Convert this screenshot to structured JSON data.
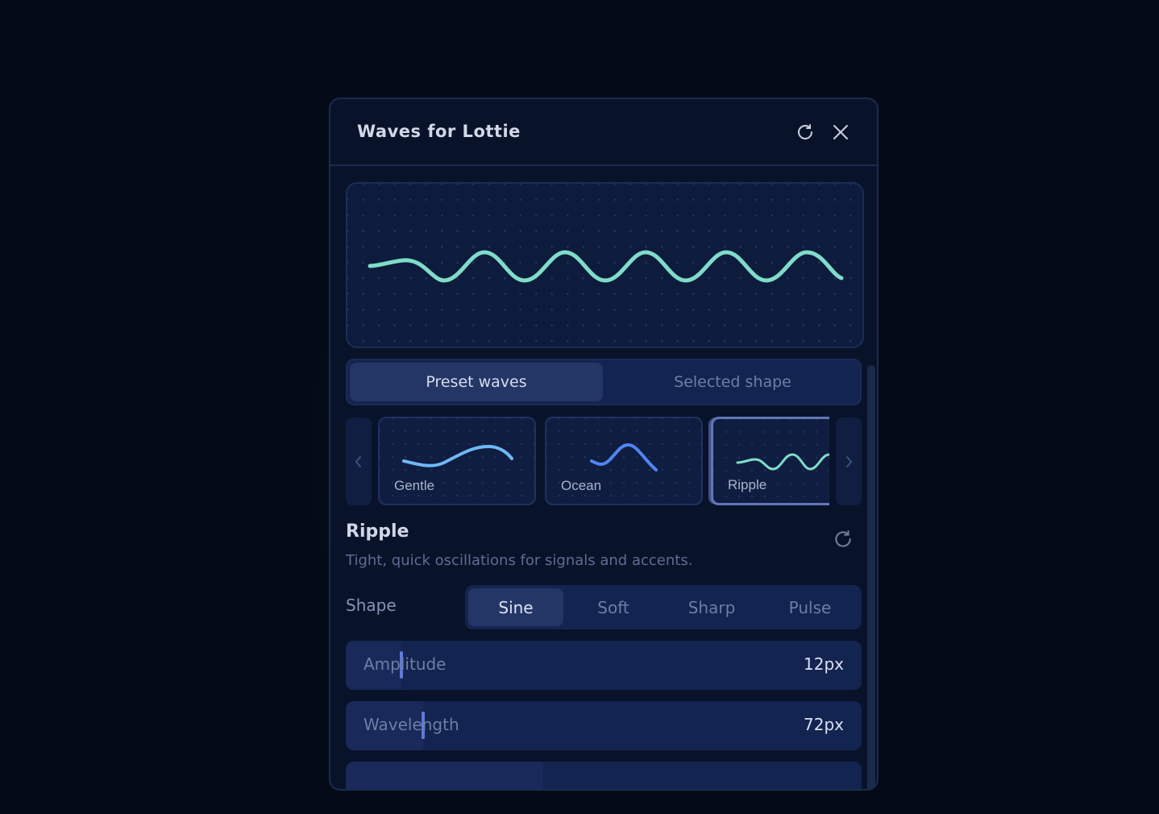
{
  "window": {
    "title": "Waves for Lottie",
    "refresh_icon": "refresh-icon",
    "close_icon": "close-icon"
  },
  "preview": {
    "wave_color": "#7fdcc9"
  },
  "tabs": [
    {
      "label": "Preset waves",
      "active": true
    },
    {
      "label": "Selected shape",
      "active": false
    }
  ],
  "presets": [
    {
      "label": "Gentle",
      "color": "#6fb8f5",
      "selected": false
    },
    {
      "label": "Ocean",
      "color": "#4f86f0",
      "selected": false
    },
    {
      "label": "Ripple",
      "color": "#7fdcc9",
      "selected": true
    }
  ],
  "detail": {
    "title": "Ripple",
    "description": "Tight, quick oscillations for signals and accents."
  },
  "shape": {
    "label": "Shape",
    "options": [
      "Sine",
      "Soft",
      "Sharp",
      "Pulse"
    ],
    "selected": "Sine"
  },
  "sliders": [
    {
      "label": "Amplitude",
      "value": "12px"
    },
    {
      "label": "Wavelength",
      "value": "72px"
    }
  ],
  "colors": {
    "background": "#040b17",
    "panel": "#08132a",
    "accent": "#5f7ad9"
  }
}
